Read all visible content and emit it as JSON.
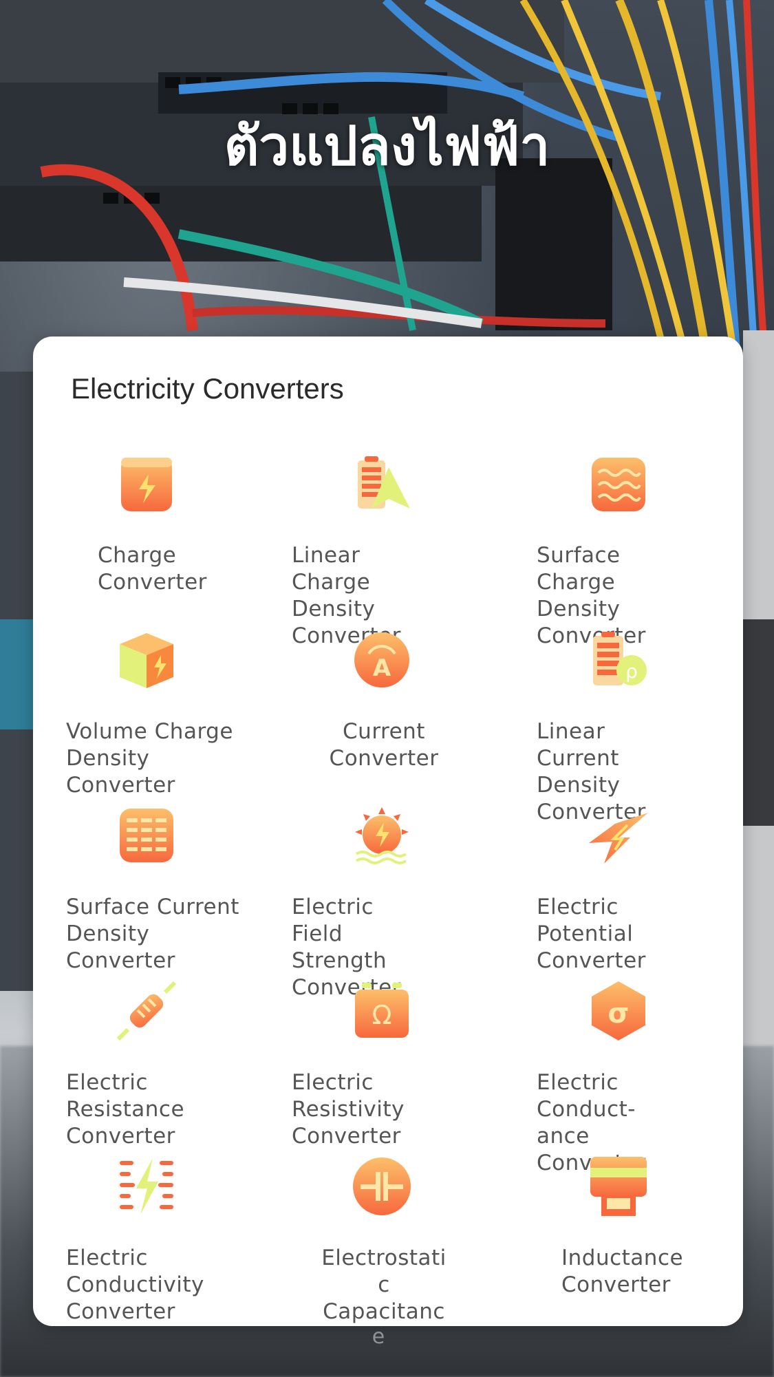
{
  "header": {
    "title": "ตัวแปลงไฟฟ้า"
  },
  "card": {
    "title": "Electricity Converters"
  },
  "colors": {
    "icon_orange": "#f7683d",
    "icon_light": "#fcbf6b",
    "icon_yellow": "#e2f17a",
    "card_bg": "#ffffff",
    "label_text": "#555555"
  },
  "converters": [
    {
      "label": "Charge\nConverter",
      "icon": "battery-charge-icon"
    },
    {
      "label": "Linear Charge\nDensity Converter",
      "icon": "battery-triangle-icon"
    },
    {
      "label": "Surface Charge\nDensity\nConverter",
      "icon": "waves-icon"
    },
    {
      "label": "Volume Charge\nDensity Converter",
      "icon": "cube-bolt-icon"
    },
    {
      "label": "Current\nConverter",
      "icon": "ammeter-icon"
    },
    {
      "label": "Linear Current\nDensity\nConverter",
      "icon": "battery-rho-icon"
    },
    {
      "label": "Surface Current\nDensity Converter",
      "icon": "grid-icon"
    },
    {
      "label": "Electric Field\nStrength Converter",
      "icon": "sun-bolt-icon"
    },
    {
      "label": "Electric\nPotential\nConverter",
      "icon": "lightning-icon"
    },
    {
      "label": "Electric Resistance\nConverter",
      "icon": "resistor-icon"
    },
    {
      "label": "Electric Resistivity\nConverter",
      "icon": "battery-omega-icon"
    },
    {
      "label": "Electric Conduct-\nance Converter",
      "icon": "sigma-hexagon-icon"
    },
    {
      "label": "Electric Conductivity\nConverter",
      "icon": "bolt-lines-icon"
    },
    {
      "label": "Electrostati\nc\nCapacitanc",
      "icon": "capacitor-icon"
    },
    {
      "label": "Inductance\nConverter",
      "icon": "inductor-icon"
    }
  ],
  "overflow_text": "e"
}
